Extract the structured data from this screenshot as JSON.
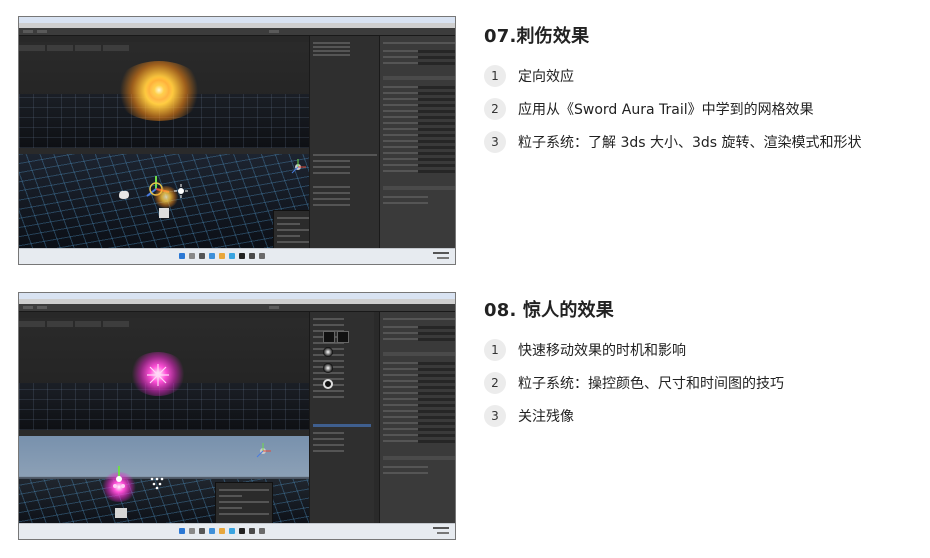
{
  "sections": [
    {
      "title": "07.刺伤效果",
      "items": [
        {
          "num": "1",
          "text": "定向效应"
        },
        {
          "num": "2",
          "text": "应用从《Sword Aura Trail》中学到的网格效果"
        },
        {
          "num": "3",
          "text": "粒子系统：了解 3ds 大小、3ds 旋转、渲染模式和形状"
        }
      ],
      "screenshot": {
        "effect_color": "#ffcc40",
        "icon": "unity-editor-screenshot"
      }
    },
    {
      "title": "08. 惊人的效果",
      "items": [
        {
          "num": "1",
          "text": "快速移动效果的时机和影响"
        },
        {
          "num": "2",
          "text": "粒子系统：操控颜色、尺寸和时间图的技巧"
        },
        {
          "num": "3",
          "text": "关注残像"
        }
      ],
      "screenshot": {
        "effect_color": "#ff4fd8",
        "icon": "unity-editor-screenshot"
      }
    }
  ],
  "colors": {
    "editor_bg": "#2a2a2a",
    "taskbar": "#e7ebf0",
    "badge_bg": "#ececec",
    "text": "#222222"
  }
}
